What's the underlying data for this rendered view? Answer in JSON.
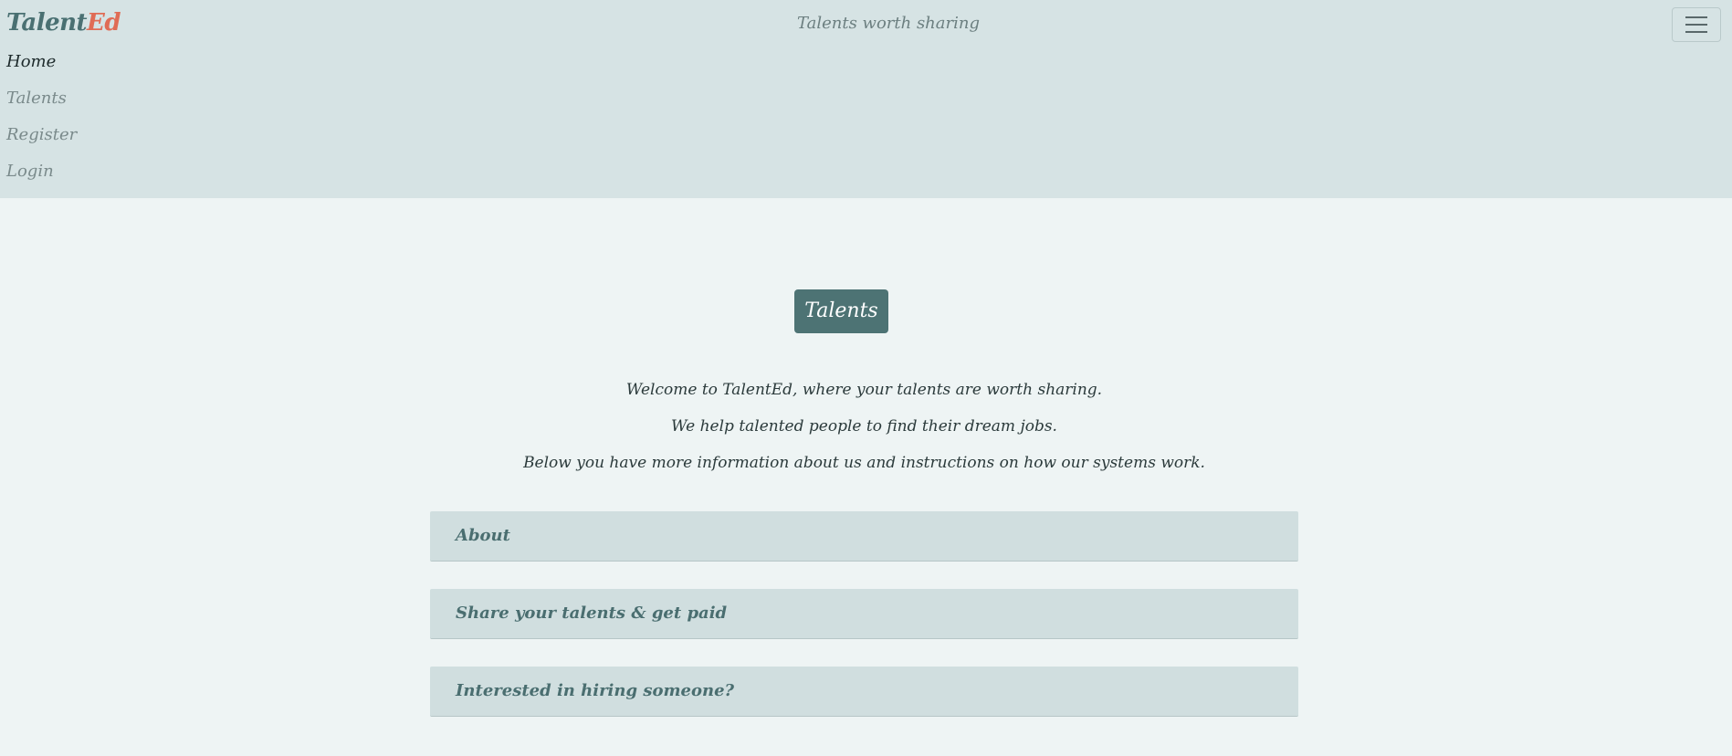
{
  "header": {
    "brand_main": "Talent",
    "brand_accent": "Ed",
    "tagline": "Talents worth sharing",
    "menu_toggle_icon": "hamburger-icon"
  },
  "nav": {
    "items": [
      {
        "label": "Home",
        "active": true
      },
      {
        "label": "Talents",
        "active": false
      },
      {
        "label": "Register",
        "active": false
      },
      {
        "label": "Login",
        "active": false
      }
    ]
  },
  "hero": {
    "badge": "Talents",
    "lines": [
      "Welcome to TalentEd, where your talents are worth sharing.",
      "We help talented people to find their dream jobs.",
      "Below you have more information about us and instructions on how our systems work."
    ]
  },
  "accordion": {
    "items": [
      {
        "title": "About"
      },
      {
        "title": "Share your talents & get paid"
      },
      {
        "title": "Interested in hiring someone?"
      }
    ]
  },
  "colors": {
    "header_bg": "#d6e3e4",
    "page_bg": "#eef4f4",
    "brand": "#4a7072",
    "brand_accent": "#e06c55",
    "badge_bg": "#4d7374",
    "accordion_bg": "#d0dedf"
  }
}
